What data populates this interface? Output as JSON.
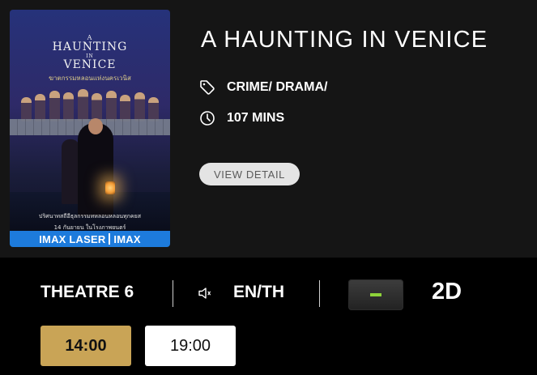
{
  "movie": {
    "title": "A HAUNTING IN VENICE",
    "genre": "CRIME/ DRAMA/",
    "duration": "107 MINS",
    "view_detail_label": "VIEW DETAIL",
    "genre_icon": "tag-icon",
    "duration_icon": "clock-icon"
  },
  "poster": {
    "title_line1": "A",
    "title_line2": "HAUNTING",
    "title_line3": "IN",
    "title_line4": "VENICE",
    "thai_title": "ฆาตกรรมหลอนแห่งนครเวนิส",
    "tagline": "ปริศนาทสถีอีธุลกรรมทหลอนหลอนทุกคยส",
    "release_date": "14 กันยายน ในโรงภาพยนตร์",
    "format_bar_left": "IMAX LASER",
    "format_bar_right": "IMAX"
  },
  "showtime": {
    "theatre": "THEATRE 6",
    "language": "EN/TH",
    "audio_icon": "speaker-icon",
    "format": "2D",
    "rating_color": "#8ed33a",
    "times": [
      {
        "label": "14:00",
        "selected": true
      },
      {
        "label": "19:00",
        "selected": false
      }
    ]
  },
  "colors": {
    "accent_gold": "#c9a456",
    "panel_bg": "#151515",
    "imax_blue": "#1d7bdc"
  }
}
